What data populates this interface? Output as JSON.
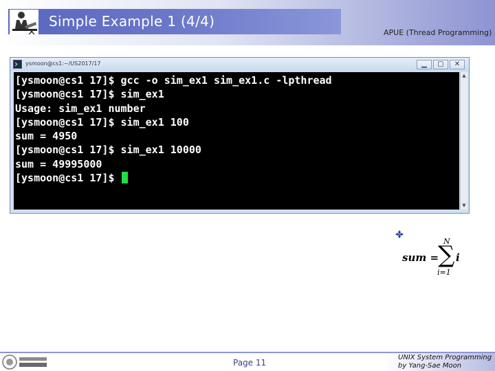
{
  "header": {
    "title": "Simple Example 1 (4/4)",
    "course": "APUE (Thread Programming)",
    "icon": "person-at-desk-icon"
  },
  "window": {
    "title": "ysmoon@cs1:~/US2017/17",
    "buttons": [
      "▁",
      "▢",
      "✕"
    ],
    "terminal_lines": [
      "[ysmoon@cs1 17]$ gcc -o sim_ex1 sim_ex1.c -lpthread",
      "[ysmoon@cs1 17]$ sim_ex1",
      "Usage: sim_ex1 number",
      "[ysmoon@cs1 17]$ sim_ex1 100",
      "sum = 4950",
      "[ysmoon@cs1 17]$ sim_ex1 10000",
      "sum = 49995000",
      "[ysmoon@cs1 17]$ "
    ],
    "cursor_color": "#22dd44"
  },
  "formula": {
    "lhs": "sum =",
    "upper": "N",
    "sigma": "∑",
    "lower": "i=1",
    "term": "i"
  },
  "footer": {
    "page": "Page 11",
    "course_line1": "UNIX System Programming",
    "course_line2": "by Yang-Sae Moon",
    "logo": "university-logo-icon"
  },
  "colors": {
    "accent": "#5a66bf",
    "terminal_bg": "#000000",
    "page_text": "#3b3f8a"
  }
}
